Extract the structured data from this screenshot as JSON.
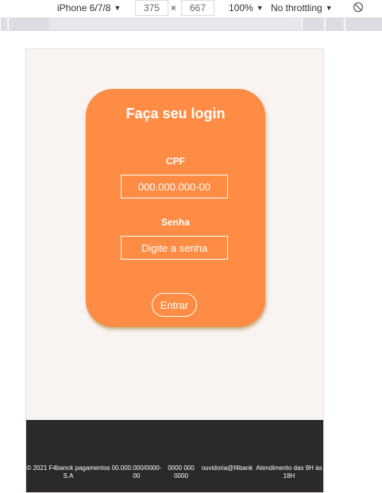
{
  "devtools": {
    "device": "iPhone 6/7/8",
    "width": "375",
    "separator": "×",
    "height": "667",
    "zoom": "100%",
    "throttling": "No throttling"
  },
  "login": {
    "title": "Faça seu login",
    "cpf_label": "CPF",
    "cpf_placeholder": "000.000.000-00",
    "password_label": "Senha",
    "password_placeholder": "Digite a senha",
    "submit_label": "Entrar"
  },
  "footer": {
    "copyright": "© 2021 F4banck pagamentos S.A",
    "cnpj": "00.000.000/0000-00",
    "phone": "0000 000 0000",
    "email": "ouvidoria@f4bank",
    "hours": "Atendimento das 9H às 18H"
  },
  "colors": {
    "card": "#ff8c45",
    "page_background": "#f9f4f1",
    "footer": "#2a2a2a"
  }
}
